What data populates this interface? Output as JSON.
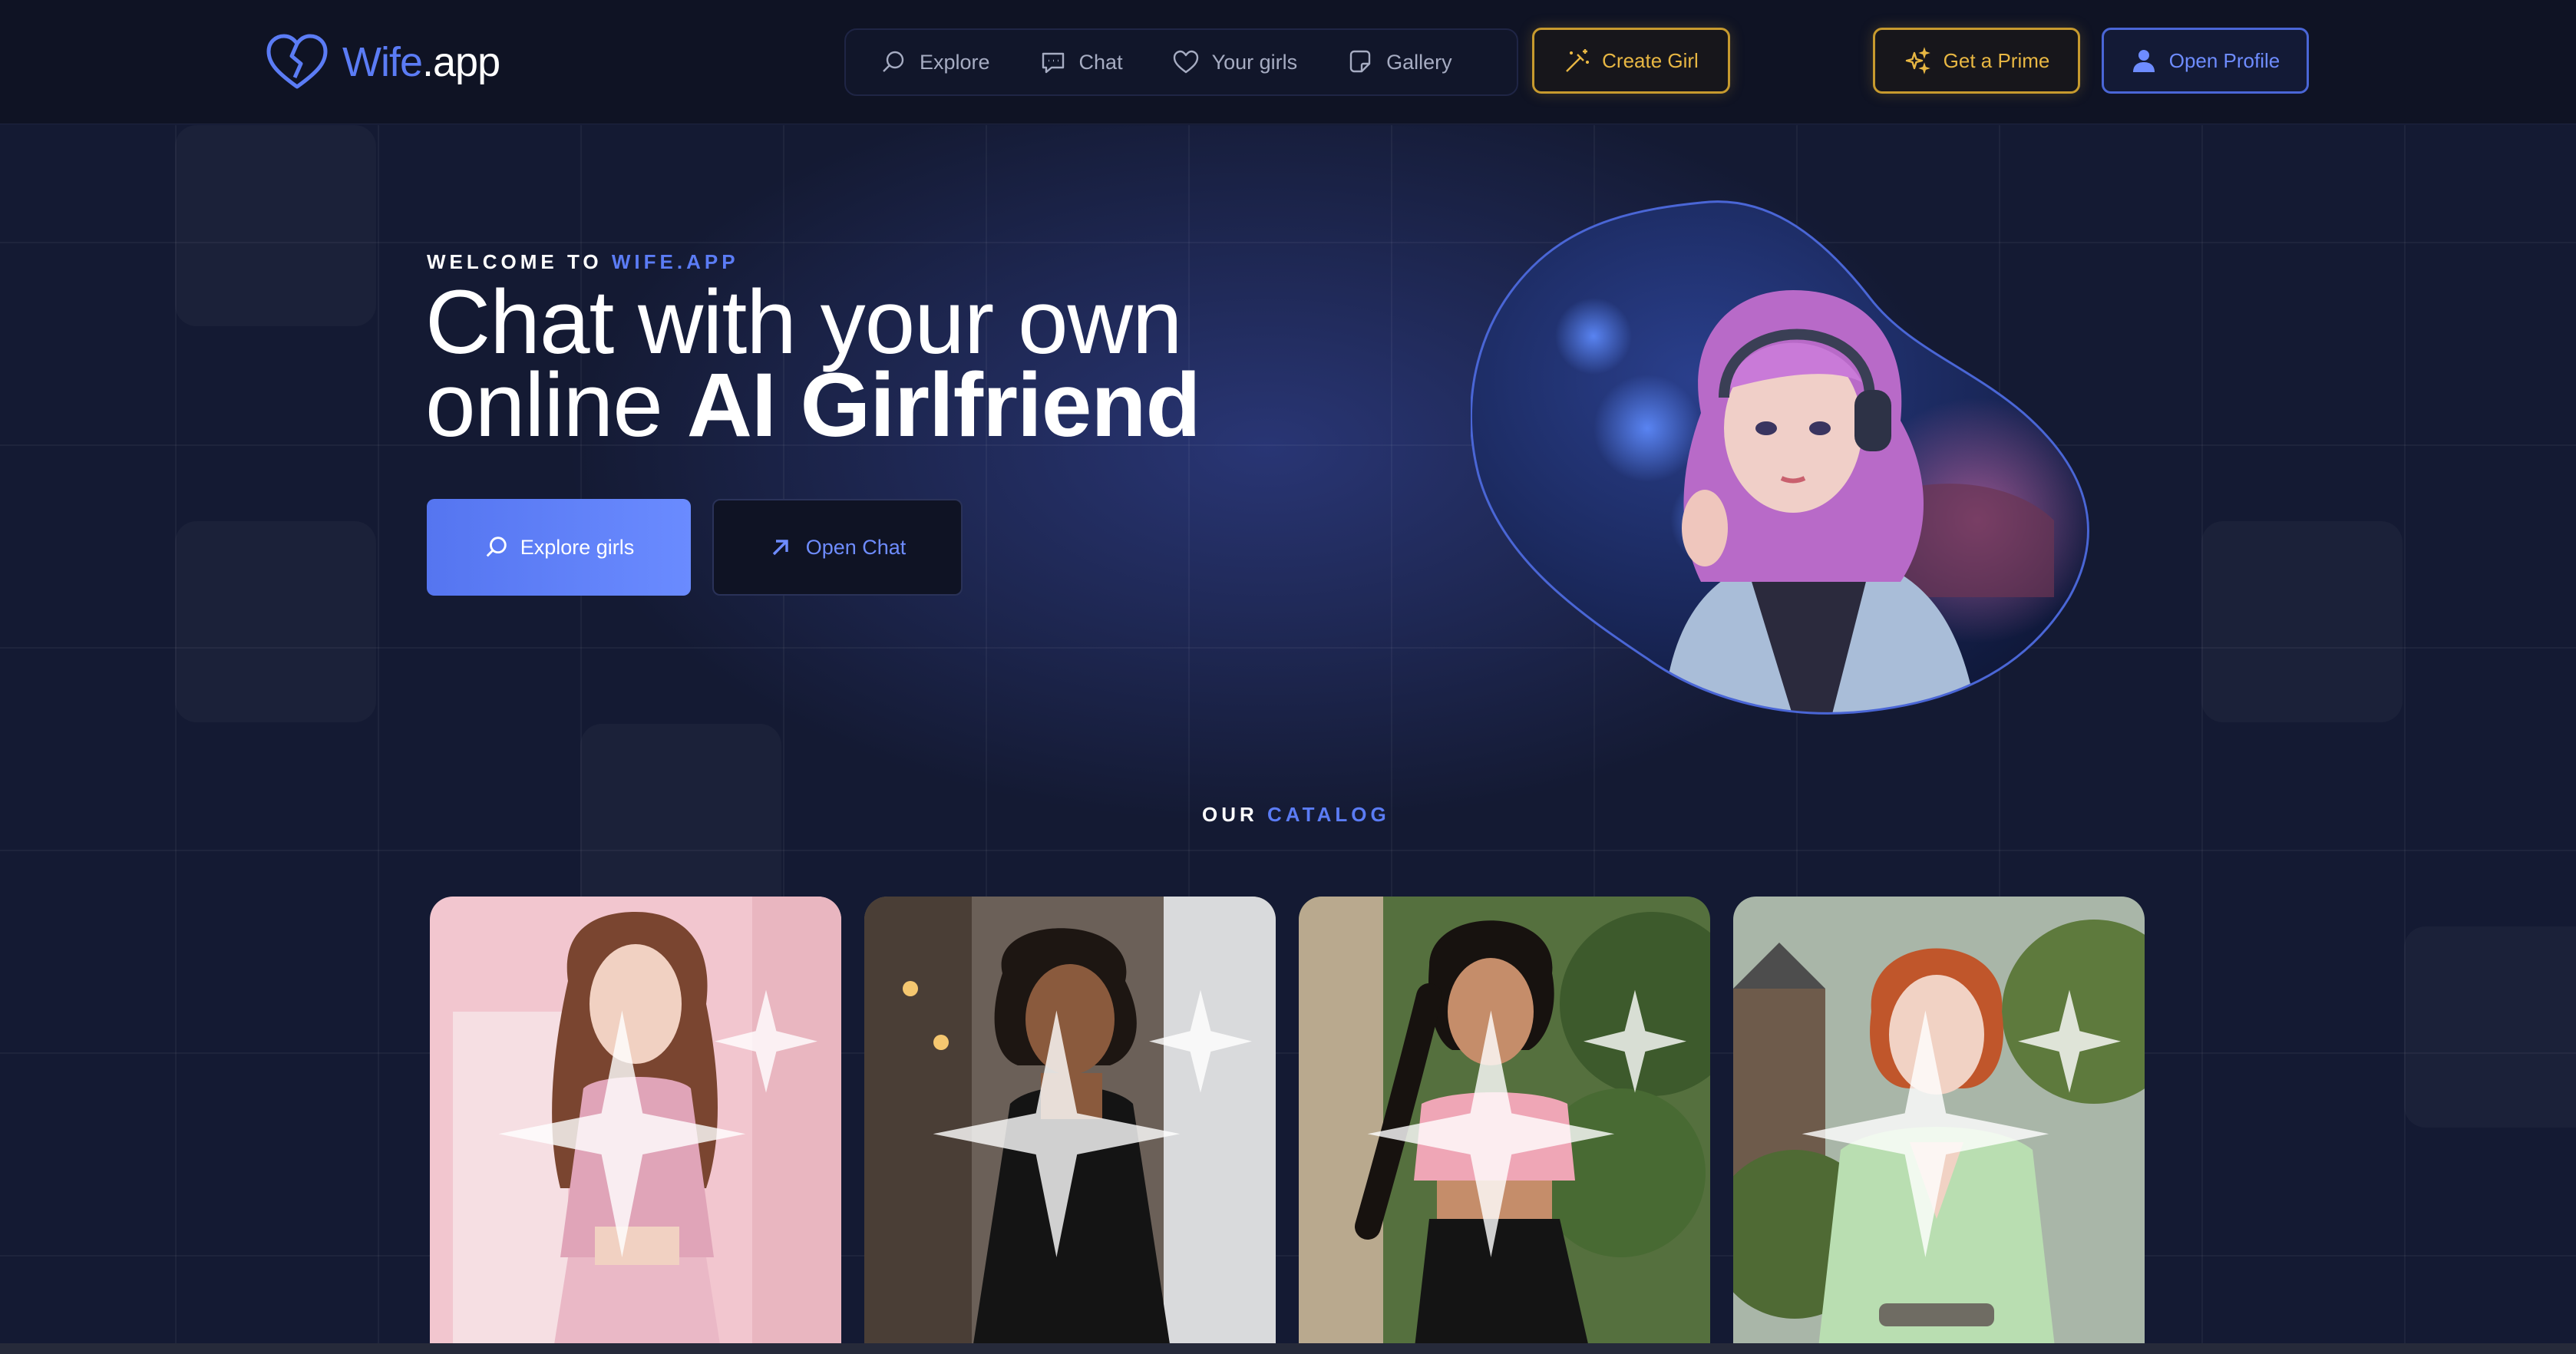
{
  "header": {
    "logo_brand": "Wife",
    "logo_tld": ".app",
    "nav": [
      {
        "label": "Explore",
        "icon": "search-icon"
      },
      {
        "label": "Chat",
        "icon": "chat-icon"
      },
      {
        "label": "Your girls",
        "icon": "heart-icon"
      },
      {
        "label": "Gallery",
        "icon": "gallery-icon"
      }
    ],
    "create_girl": "Create Girl",
    "get_prime": "Get a Prime",
    "open_profile": "Open Profile"
  },
  "hero": {
    "welcome_prefix": "WELCOME TO",
    "welcome_brand": "WIFE.APP",
    "headline_line1": "Chat with your own",
    "headline_line2_plain": "online",
    "headline_line2_bold": "AI Girlfriend",
    "explore_button": "Explore girls",
    "open_chat_button": "Open Chat"
  },
  "catalog": {
    "title_prefix": "OUR",
    "title_accent": "CATALOG",
    "cards": [
      {
        "theme": "pink-outfit"
      },
      {
        "theme": "black-dress-cafe"
      },
      {
        "theme": "pink-top-garden"
      },
      {
        "theme": "green-blouse-street"
      }
    ]
  },
  "colors": {
    "accent_blue": "#5b7cf5",
    "gold": "#e8b743",
    "background": "#141a33",
    "header_bg": "#0f1324"
  }
}
